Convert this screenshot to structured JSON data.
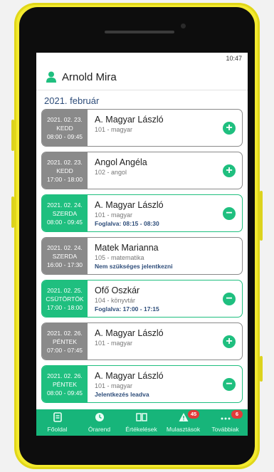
{
  "status_bar": {
    "time": "10:47"
  },
  "header": {
    "user_name": "Arnold Mira"
  },
  "month_label": "2021. február",
  "lessons": [
    {
      "date": "2021. 02. 23.",
      "day": "KEDD",
      "time": "08:00 - 09:45",
      "teacher": "A. Magyar László",
      "subject": "101 - magyar",
      "note": "",
      "action": "+",
      "state": "available"
    },
    {
      "date": "2021. 02. 23.",
      "day": "KEDD",
      "time": "17:00 - 18:00",
      "teacher": "Angol Angéla",
      "subject": "102 - angol",
      "note": "",
      "action": "+",
      "state": "available"
    },
    {
      "date": "2021. 02. 24.",
      "day": "SZERDA",
      "time": "08:00 - 09:45",
      "teacher": "A. Magyar László",
      "subject": "101 - magyar",
      "note": "Foglalva: 08:15 - 08:30",
      "action": "−",
      "state": "booked"
    },
    {
      "date": "2021. 02. 24.",
      "day": "SZERDA",
      "time": "16:00 - 17:30",
      "teacher": "Matek Marianna",
      "subject": "105 - matematika",
      "note": "Nem szükséges jelentkezni",
      "action": "",
      "state": "info"
    },
    {
      "date": "2021. 02. 25.",
      "day": "CSÜTÖRTÖK",
      "time": "17:00 - 18:00",
      "teacher": "Ofő Oszkár",
      "subject": "104 - könyvtár",
      "note": "Foglalva: 17:00 - 17:15",
      "action": "−",
      "state": "booked"
    },
    {
      "date": "2021. 02. 26.",
      "day": "PÉNTEK",
      "time": "07:00 - 07:45",
      "teacher": "A. Magyar László",
      "subject": "101 - magyar",
      "note": "",
      "action": "+",
      "state": "available"
    },
    {
      "date": "2021. 02. 26.",
      "day": "PÉNTEK",
      "time": "08:00 - 09:45",
      "teacher": "A. Magyar László",
      "subject": "101 - magyar",
      "note": "Jelentkezés leadva",
      "action": "−",
      "state": "booked"
    }
  ],
  "nav": [
    {
      "label": "Főoldal",
      "icon": "home-icon",
      "badge": ""
    },
    {
      "label": "Órarend",
      "icon": "clock-icon",
      "badge": ""
    },
    {
      "label": "Értékelések",
      "icon": "book-icon",
      "badge": ""
    },
    {
      "label": "Mulasztások",
      "icon": "warning-icon",
      "badge": "45"
    },
    {
      "label": "Továbbiak",
      "icon": "more-icon",
      "badge": "6"
    }
  ],
  "colors": {
    "accent": "#1fbf7f",
    "nav_bg": "#17b57a",
    "inactive": "#8a8a8a",
    "badge": "#e23a3a",
    "month": "#2e4d7a"
  }
}
